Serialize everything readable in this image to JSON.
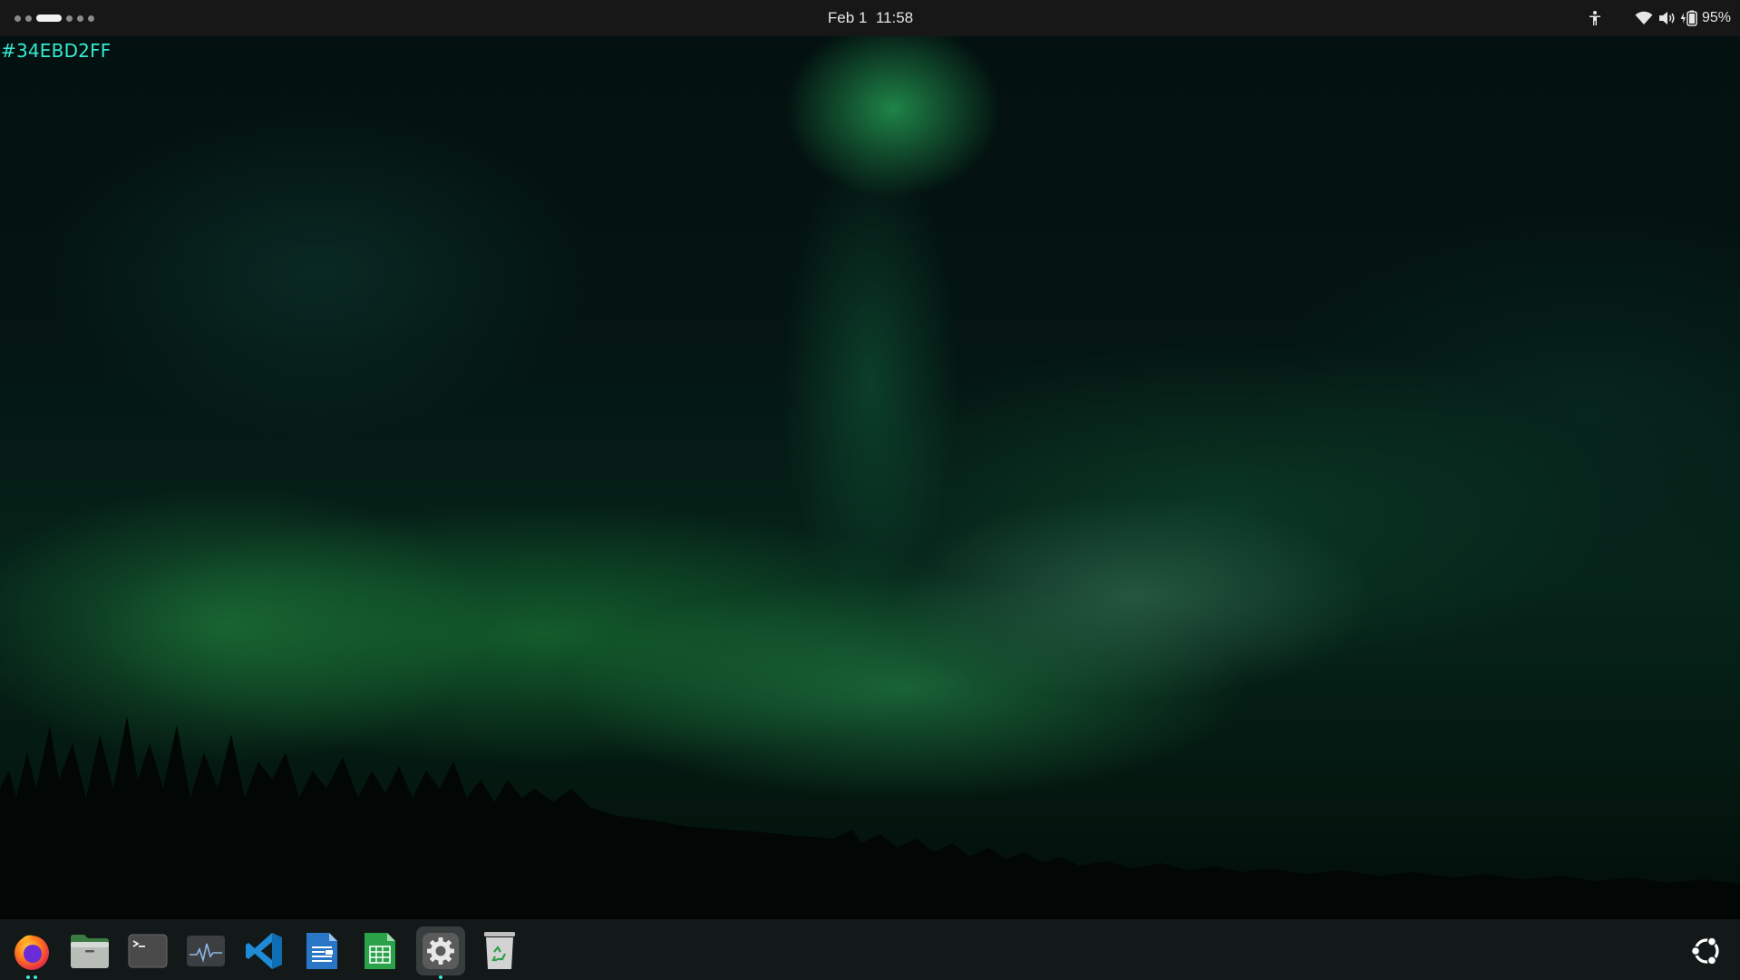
{
  "top_bar": {
    "clock": {
      "date": "Feb 1",
      "time": "11:58"
    },
    "workspaces": {
      "count": 6,
      "active_index": 2
    },
    "tray": {
      "icons": [
        "accessibility-icon",
        "wifi-icon",
        "volume-icon",
        "battery-icon"
      ],
      "battery_percent": "95%"
    }
  },
  "desktop": {
    "color_label": "#34EBD2FF"
  },
  "dock": {
    "apps": [
      {
        "name": "Firefox",
        "icon": "firefox-icon",
        "running": true
      },
      {
        "name": "Files",
        "icon": "files-icon",
        "running": false
      },
      {
        "name": "Terminal",
        "icon": "terminal-icon",
        "running": false
      },
      {
        "name": "System Monitor",
        "icon": "system-monitor-icon",
        "running": false
      },
      {
        "name": "Visual Studio Code",
        "icon": "vscode-icon",
        "running": false
      },
      {
        "name": "LibreOffice Writer",
        "icon": "writer-icon",
        "running": false
      },
      {
        "name": "LibreOffice Calc",
        "icon": "calc-icon",
        "running": false
      },
      {
        "name": "Settings",
        "icon": "settings-icon",
        "running": true
      },
      {
        "name": "Trash",
        "icon": "trash-icon",
        "running": false
      }
    ],
    "show_apps_icon": "ubuntu-apps-icon"
  },
  "colors": {
    "accent": "#34EBD2",
    "top_bar": "#171717"
  }
}
